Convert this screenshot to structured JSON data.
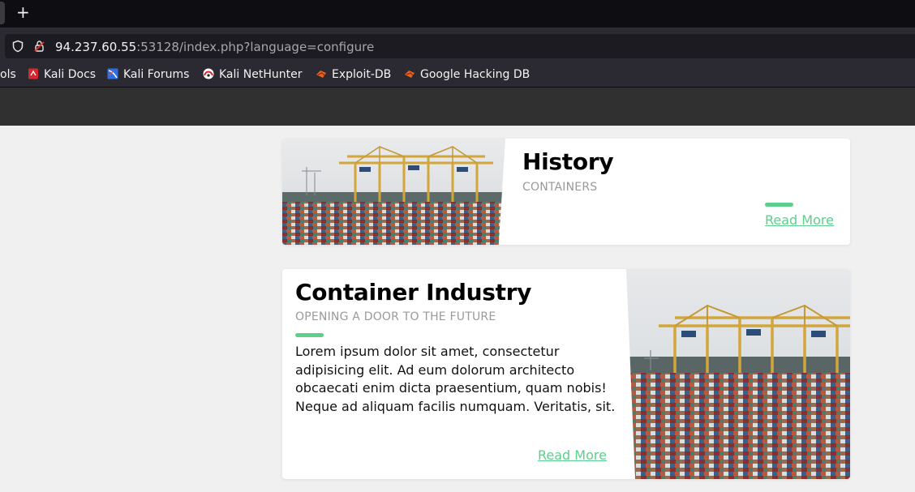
{
  "browser": {
    "new_tab_label": "+",
    "url_host": "94.237.60.55",
    "url_rest": ":53128/index.php?language=configure",
    "bookmarks": [
      {
        "label": "ols",
        "icon": "none"
      },
      {
        "label": "Kali Docs",
        "icon": "kali-docs-icon"
      },
      {
        "label": "Kali Forums",
        "icon": "kali-forums-icon"
      },
      {
        "label": "Kali NetHunter",
        "icon": "kali-nethunter-icon"
      },
      {
        "label": "Exploit-DB",
        "icon": "exploit-db-icon"
      },
      {
        "label": "Google Hacking DB",
        "icon": "google-hacking-db-icon"
      }
    ]
  },
  "cards": [
    {
      "title": "History",
      "subtitle": "CONTAINERS",
      "read_more": "Read More"
    },
    {
      "title": "Container Industry",
      "subtitle": "OPENING A DOOR TO THE FUTURE",
      "body": "Lorem ipsum dolor sit amet, consectetur adipisicing elit. Ad eum dolorum architecto obcaecati enim dicta praesentium, quam nobis! Neque ad aliquam facilis numquam. Veritatis, sit.",
      "read_more": "Read More"
    }
  ],
  "colors": {
    "accent": "#5ccf8c",
    "page_bg": "#f0f0f0",
    "site_header": "#303030",
    "browser_chrome": "#2b2a33"
  }
}
